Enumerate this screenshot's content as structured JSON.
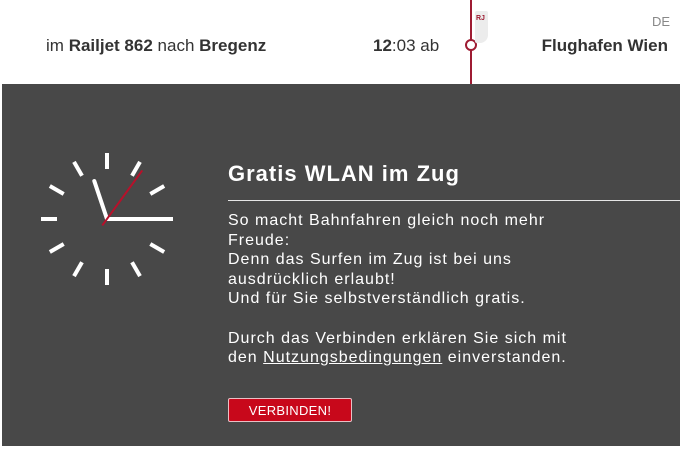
{
  "header": {
    "train_prefix": "im",
    "train_name": "Railjet 862",
    "train_connector": "nach",
    "train_destination": "Bregenz",
    "departure_hour": "12",
    "departure_minutes": ":03 ab",
    "train_badge": "RJ",
    "station": "Flughafen Wien",
    "language": "DE"
  },
  "main": {
    "title": "Gratis WLAN im Zug",
    "paragraph1": [
      "So macht Bahnfahren gleich noch mehr",
      "Freude:",
      "Denn das Surfen im Zug ist bei uns",
      "ausdrücklich erlaubt!",
      "Und für Sie selbstverständlich gratis."
    ],
    "paragraph2_line1": "Durch das Verbinden erklären Sie sich mit",
    "paragraph2_prefix": "den",
    "terms_link": "Nutzungsbedingungen",
    "paragraph2_suffix": "einverstanden.",
    "connect_button": "VERBINDEN!"
  },
  "clock": {
    "hour": 12,
    "minute": 3,
    "second": 8
  },
  "colors": {
    "accent": "#9e1b32",
    "button": "#c8081b",
    "panel": "#484848"
  },
  "icons": {
    "clock": "clock-icon",
    "badge": "railjet-badge"
  }
}
